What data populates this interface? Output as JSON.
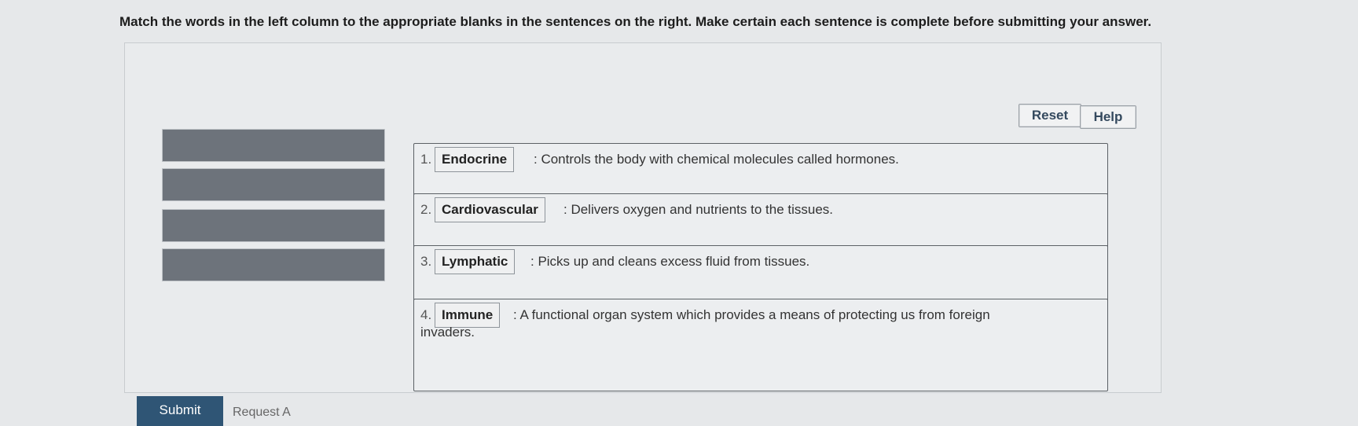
{
  "instructions": "Match the words in the left column to the appropriate blanks in the sentences on the right. Make certain each sentence is complete before submitting your answer.",
  "buttons": {
    "reset": "Reset",
    "help": "Help",
    "submit": "Submit",
    "request_answer": "Request A"
  },
  "sentences": [
    {
      "number": "1.",
      "word": "Endocrine",
      "text": ": Controls the body with chemical molecules called hormones."
    },
    {
      "number": "2.",
      "word": "Cardiovascular",
      "text": ": Delivers oxygen and nutrients to the tissues."
    },
    {
      "number": "3.",
      "word": "Lymphatic",
      "text": ": Picks up and cleans excess fluid from tissues."
    },
    {
      "number": "4.",
      "word": "Immune",
      "text": ": A functional organ system which provides a means of protecting us from foreign",
      "text_cont": "invaders."
    }
  ]
}
